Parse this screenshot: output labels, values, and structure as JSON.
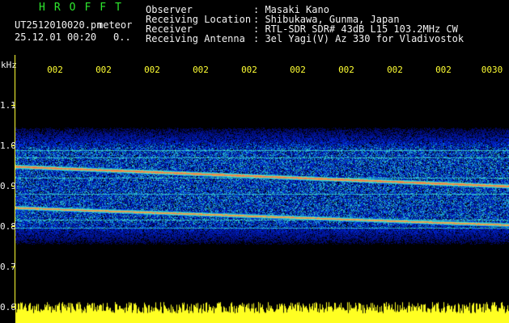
{
  "logo": "HROFFT",
  "header": {
    "filename": "UT2512010020.pn",
    "meteor_label": "meteor",
    "datetime": "25.12.01 00:20",
    "count": "0..",
    "labels": [
      "Observer",
      "Receiving Location",
      "Receiver",
      "Receiving Antenna"
    ],
    "values": [
      ": Masaki Kano",
      ": Shibukawa, Gunma, Japan",
      ": RTL-SDR SDR# 43dB L15 103.2MHz CW",
      ": 3el Yagi(V) Az 330 for Vladivostok"
    ]
  },
  "axis": {
    "unit": "kHz",
    "y_ticks": [
      "1.1",
      "1.0",
      "0.9",
      "0.8",
      "0.7",
      "0.6"
    ],
    "time_ticks": [
      "002",
      "002",
      "002",
      "002",
      "002",
      "002",
      "002",
      "002",
      "002",
      "0030"
    ]
  },
  "colors": {
    "background": "#000000",
    "text": "#f2f2f2",
    "accent_yellow": "#ffff33",
    "logo_green": "#2ee82e"
  }
}
